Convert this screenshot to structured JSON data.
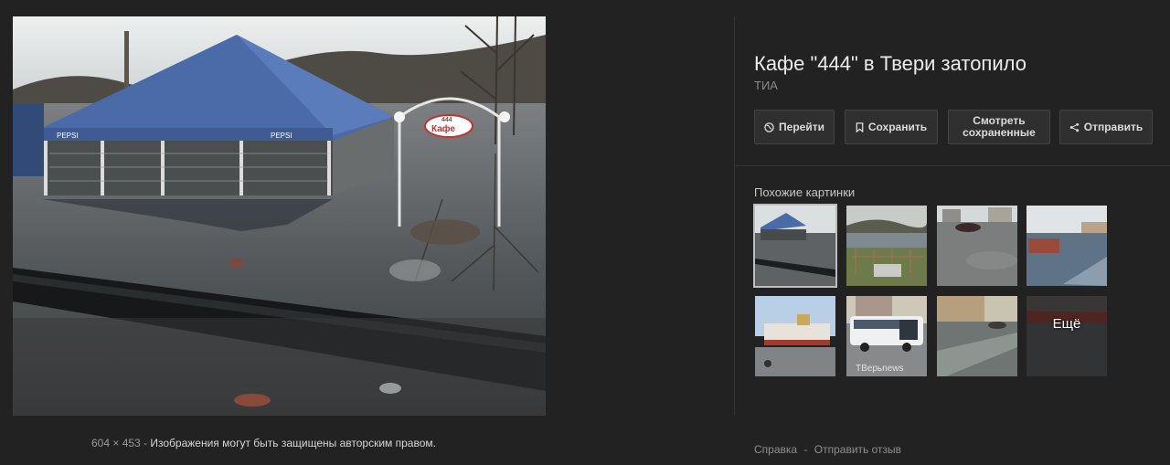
{
  "main_image": {
    "sign_text": "Кафе",
    "sign_number": "444",
    "tent_brand": "PEPSI"
  },
  "image_meta": {
    "dimensions": "604 × 453",
    "separator": " - ",
    "copyright": "Изображения могут быть защищены авторским правом."
  },
  "details": {
    "title": "Кафе \"444\" в Твери затопило",
    "source": "ТИА"
  },
  "actions": {
    "go_label": "Перейти",
    "save_label": "Сохранить",
    "view_saved_line1": "Смотреть",
    "view_saved_line2": "сохраненные",
    "send_label": "Отправить"
  },
  "similar": {
    "label": "Похожие картинки",
    "more_label": "Ещё",
    "thumb6_watermark": "ТВерьnews"
  },
  "footer": {
    "help": "Справка",
    "separator": "-",
    "feedback": "Отправить отзыв"
  },
  "icons": {
    "go": "globe-icon",
    "save": "bookmark-icon",
    "send": "share-icon"
  },
  "colors": {
    "background": "#222222",
    "button_bg": "#2f2f2f",
    "button_border": "#444444",
    "title": "#ececec"
  }
}
